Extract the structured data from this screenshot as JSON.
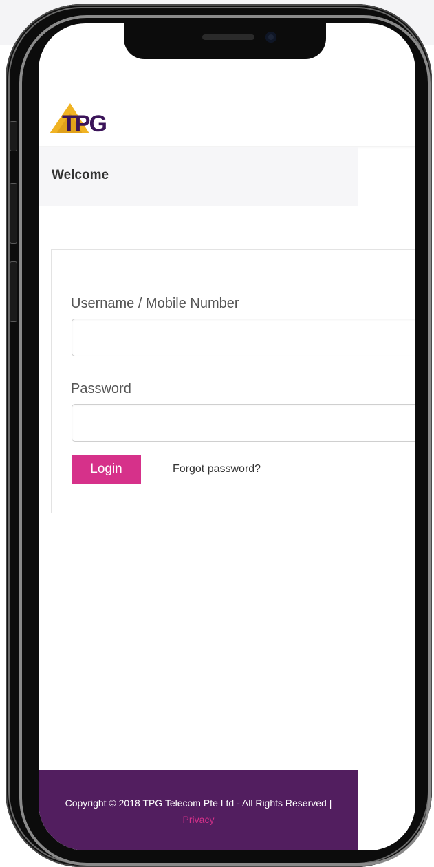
{
  "brand": {
    "logo_text": "TPG",
    "colors": {
      "primary": "#521e5f",
      "accent": "#d6318a",
      "logo_gold": "#f0b323",
      "logo_purple": "#3b1459"
    }
  },
  "welcome": {
    "title": "Welcome"
  },
  "login_form": {
    "username_label": "Username / Mobile Number",
    "username_value": "",
    "password_label": "Password",
    "password_value": "",
    "login_button": "Login",
    "forgot_link": "Forgot password?"
  },
  "footer": {
    "copyright": "Copyright © 2018 TPG Telecom Pte Ltd - All Rights Reserved |",
    "privacy_link": "Privacy"
  }
}
